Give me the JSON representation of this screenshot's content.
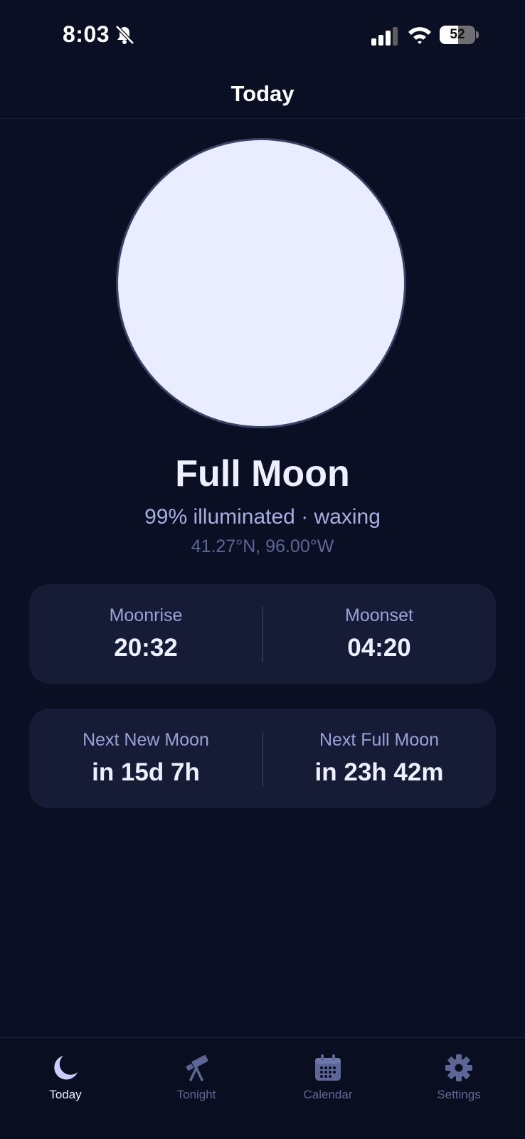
{
  "status_bar": {
    "time": "8:03",
    "battery_level": "52",
    "battery_fraction": 0.52,
    "icons": [
      "bell-slash-icon",
      "signal-icon",
      "wifi-icon",
      "battery-icon"
    ]
  },
  "nav": {
    "title": "Today"
  },
  "moon": {
    "phase_name": "Full Moon",
    "detail": "99% illuminated · waxing",
    "coordinates": "41.27°N, 96.00°W",
    "illumination": 0.99,
    "moon_color": "#e9edff"
  },
  "rise_set_card": {
    "left": {
      "label": "Moonrise",
      "value": "20:32"
    },
    "right": {
      "label": "Moonset",
      "value": "04:20"
    }
  },
  "next_phase_card": {
    "left": {
      "label": "Next New Moon",
      "value": "in 15d 7h"
    },
    "right": {
      "label": "Next Full Moon",
      "value": "in 23h 42m"
    }
  },
  "tabs": [
    {
      "label": "Today",
      "icon": "moon-icon",
      "active": true
    },
    {
      "label": "Tonight",
      "icon": "telescope-icon",
      "active": false
    },
    {
      "label": "Calendar",
      "icon": "calendar-icon",
      "active": false
    },
    {
      "label": "Settings",
      "icon": "gear-icon",
      "active": false
    }
  ],
  "colors": {
    "background": "#0b0f24",
    "card": "#161b36",
    "accent_active": "#c9cffd",
    "inactive": "#5e6696"
  }
}
